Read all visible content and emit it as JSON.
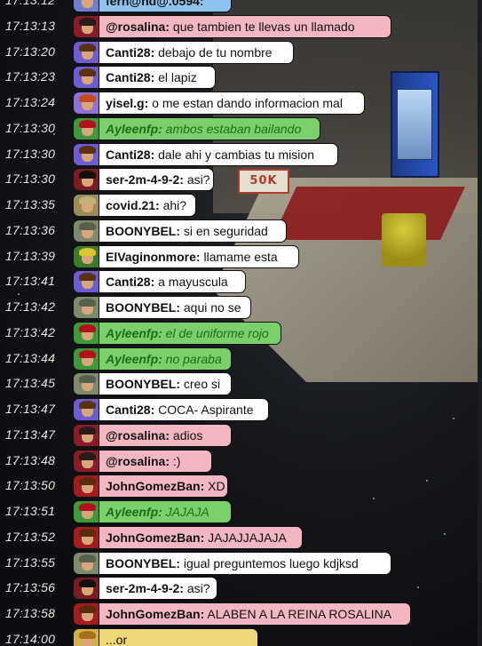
{
  "scene": {
    "sign_text": "50K"
  },
  "colors": {
    "bubble_default": "#ffffff",
    "bubble_green": "#7ad06a",
    "bubble_pink": "#f3b7c2",
    "green_text": "#1f6b1a",
    "timestamp": "#e9e9ea"
  },
  "chat": {
    "messages": [
      {
        "time": "17:13:12",
        "user": "fern@nd@.0594:",
        "text": "",
        "style": "blue",
        "avatar": "blue-hair-icon"
      },
      {
        "time": "17:13:13",
        "user": "@rosalina:",
        "text": "que tambien te llevas un llamado",
        "style": "pink",
        "avatar": "rose-avatar-icon"
      },
      {
        "time": "17:13:20",
        "user": "Canti28:",
        "text": "debajo de tu nombre",
        "style": "default",
        "avatar": "brown-hair-icon"
      },
      {
        "time": "17:13:23",
        "user": "Canti28:",
        "text": "el lapiz",
        "style": "default",
        "avatar": "brown-hair-icon"
      },
      {
        "time": "17:13:24",
        "user": "yisel.g:",
        "text": "o me estan dando informacion mal",
        "style": "default",
        "avatar": "purple-hair-icon"
      },
      {
        "time": "17:13:30",
        "user": "Ayleenfp:",
        "text": "ambos estaban bailando",
        "style": "green",
        "avatar": "red-hair-icon"
      },
      {
        "time": "17:13:30",
        "user": "Canti28:",
        "text": "dale ahi y cambias tu mision",
        "style": "default",
        "avatar": "brown-hair-icon"
      },
      {
        "time": "17:13:30",
        "user": "ser-2m-4-9-2:",
        "text": "asi?",
        "style": "default",
        "avatar": "dark-avatar-icon"
      },
      {
        "time": "17:13:35",
        "user": "covid.21:",
        "text": "ahi?",
        "style": "default",
        "avatar": "khaki-avatar-icon"
      },
      {
        "time": "17:13:36",
        "user": "BOONYBEL:",
        "text": "si en seguridad",
        "style": "default",
        "avatar": "helmet-avatar-icon"
      },
      {
        "time": "17:13:39",
        "user": "ElVaginonmore:",
        "text": "llamame esta",
        "style": "default",
        "avatar": "rasta-avatar-icon"
      },
      {
        "time": "17:13:41",
        "user": "Canti28:",
        "text": "a mayuscula",
        "style": "default",
        "avatar": "brown-hair-icon"
      },
      {
        "time": "17:13:42",
        "user": "BOONYBEL:",
        "text": "aqui no se",
        "style": "default",
        "avatar": "helmet-avatar-icon"
      },
      {
        "time": "17:13:42",
        "user": "Ayleenfp:",
        "text": "el de uniforme rojo",
        "style": "green",
        "avatar": "red-hair-icon"
      },
      {
        "time": "17:13:44",
        "user": "Ayleenfp:",
        "text": "no paraba",
        "style": "green",
        "avatar": "red-hair-icon"
      },
      {
        "time": "17:13:45",
        "user": "BOONYBEL:",
        "text": "creo si",
        "style": "default",
        "avatar": "helmet-avatar-icon"
      },
      {
        "time": "17:13:47",
        "user": "Canti28:",
        "text": "COCA- Aspirante",
        "style": "default",
        "avatar": "brown-hair-icon"
      },
      {
        "time": "17:13:47",
        "user": "@rosalina:",
        "text": "adios",
        "style": "pink",
        "avatar": "rose-avatar-icon"
      },
      {
        "time": "17:13:48",
        "user": "@rosalina:",
        "text": ":)",
        "style": "pink",
        "avatar": "rose-avatar-icon"
      },
      {
        "time": "17:13:50",
        "user": "JohnGomezBan:",
        "text": "XD",
        "style": "pink",
        "avatar": "red-helmet-icon"
      },
      {
        "time": "17:13:51",
        "user": "Ayleenfp:",
        "text": "JAJAJA",
        "style": "green",
        "avatar": "red-hair-icon"
      },
      {
        "time": "17:13:52",
        "user": "JohnGomezBan:",
        "text": "JAJAJJAJAJA",
        "style": "pink",
        "avatar": "red-helmet-icon"
      },
      {
        "time": "17:13:55",
        "user": "BOONYBEL:",
        "text": "igual preguntemos luego kdjksd",
        "style": "default",
        "avatar": "helmet-avatar-icon"
      },
      {
        "time": "17:13:56",
        "user": "ser-2m-4-9-2:",
        "text": "asi?",
        "style": "default",
        "avatar": "dark-avatar-icon"
      },
      {
        "time": "17:13:58",
        "user": "JohnGomezBan:",
        "text": "ALABEN A LA REINA ROSALINA",
        "style": "pink",
        "avatar": "red-helmet-icon"
      },
      {
        "time": "17:14:00",
        "user": "",
        "text": "...or",
        "style": "yellow",
        "avatar": "yellow-avatar-icon"
      }
    ]
  }
}
